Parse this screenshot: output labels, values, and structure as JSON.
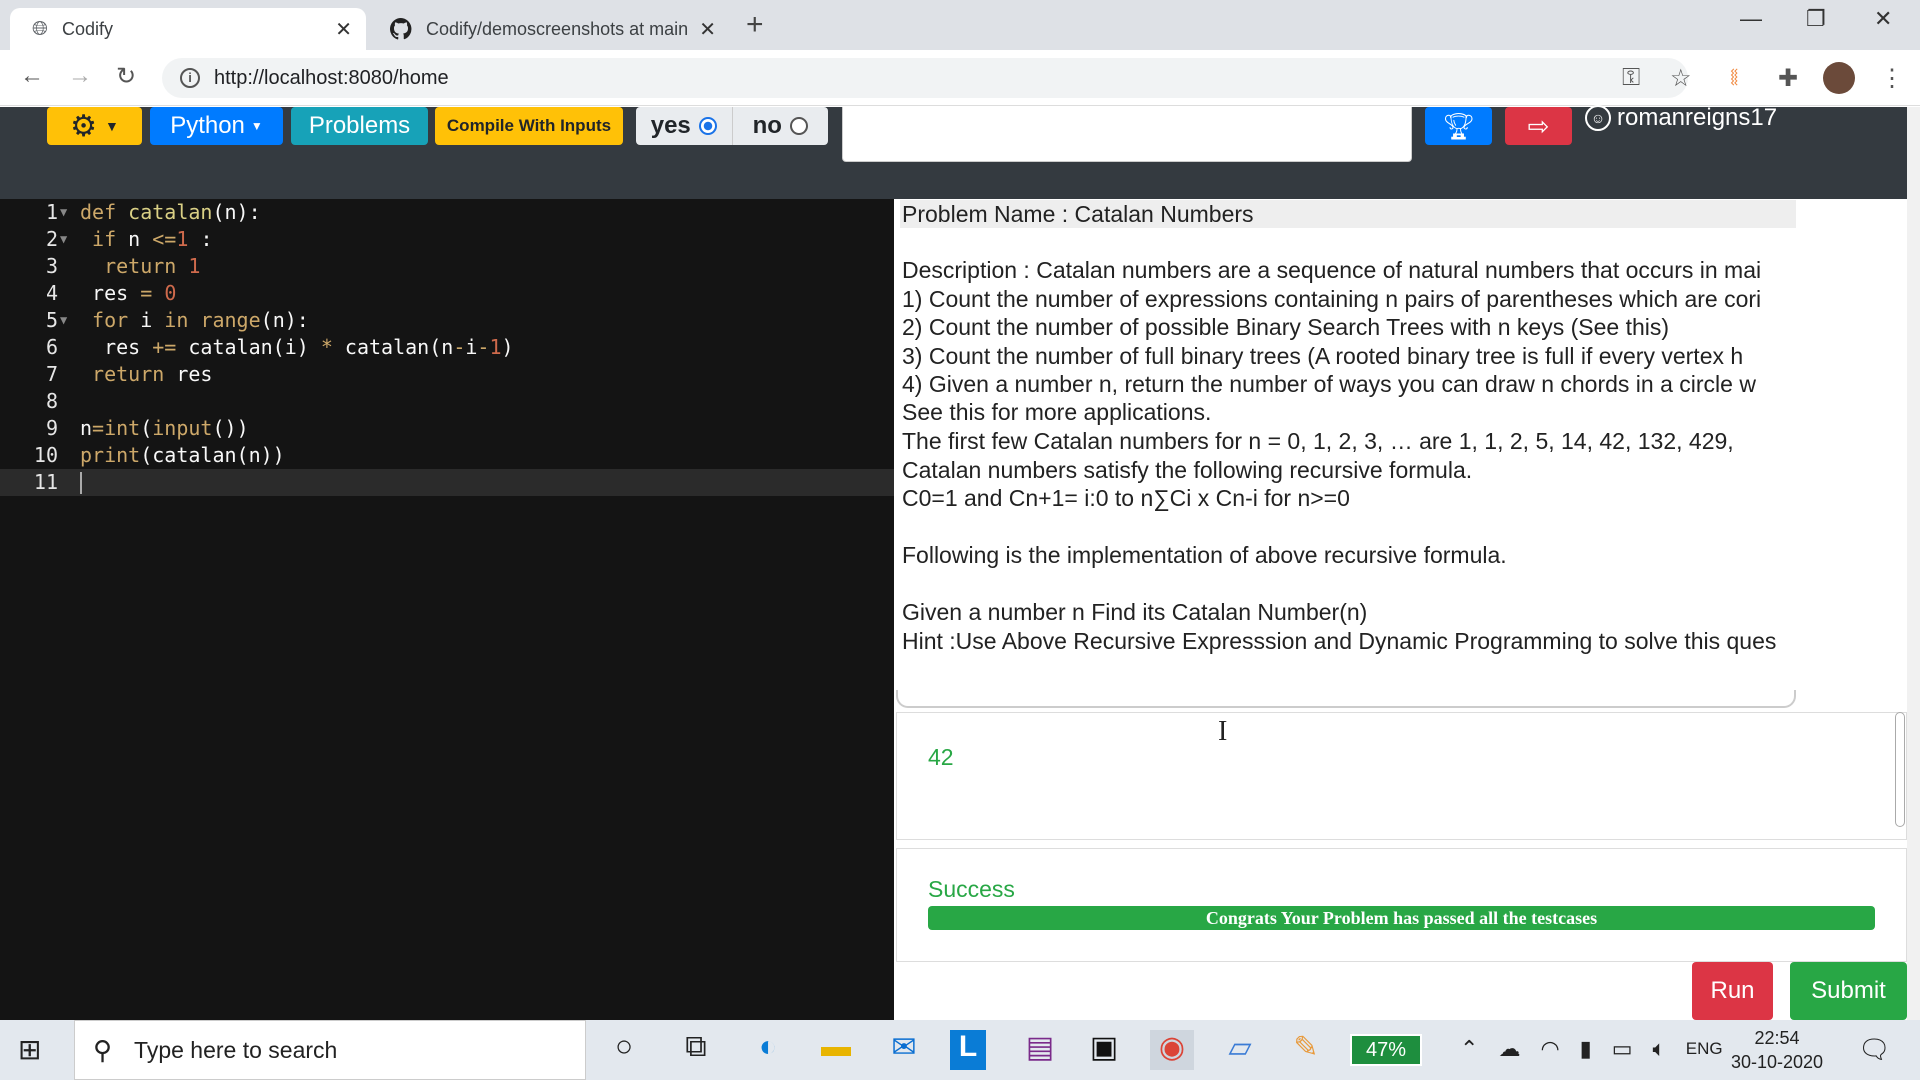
{
  "browser": {
    "tabs": [
      {
        "title": "Codify",
        "close": "✕"
      },
      {
        "title": "Codify/demoscreenshots at main",
        "close": "✕"
      }
    ],
    "new_tab": "+",
    "url": "http://localhost:8080/home",
    "icons": [
      "back-icon",
      "forward-icon",
      "reload-icon",
      "info-icon",
      "key-icon",
      "star-icon",
      "extension-icon",
      "puzzle-icon",
      "profile-avatar",
      "menu-icon"
    ]
  },
  "app": {
    "toolbar": {
      "language": "Python",
      "problems": "Problems",
      "compile_with_inputs": "Compile With Inputs",
      "yes": "yes",
      "no": "no",
      "selected_option": "yes",
      "username": "romanreigns17"
    },
    "editor": {
      "line_numbers": [
        "1",
        "2",
        "3",
        "4",
        "5",
        "6",
        "7",
        "8",
        "9",
        "10",
        "11"
      ]
    },
    "problem": {
      "name": "Problem Name : Catalan Numbers",
      "lines": [
        "Description : Catalan numbers are a sequence of natural numbers that occurs in mai",
        "1) Count the number of expressions containing n pairs of parentheses which are cori",
        "2) Count the number of possible Binary Search Trees with n keys (See this)",
        "3) Count the number of full binary trees (A rooted binary tree is full if every vertex h",
        "4) Given a number n, return the number of ways you can draw n chords in a circle w",
        "See this for more applications.",
        "The first few Catalan numbers for n = 0, 1, 2, 3, … are 1, 1, 2, 5, 14, 42, 132, 429,",
        "Catalan numbers satisfy the following recursive formula.",
        "C0=1 and Cn+1= i:0 to n∑Ci x Cn-i  for n>=0",
        "",
        "Following is the implementation of above recursive formula.",
        "",
        "Given a number n Find its Catalan Number(n)",
        "Hint :Use Above Recursive Expresssion and Dynamic Programming to solve this ques"
      ]
    },
    "output": {
      "value": "42"
    },
    "status": {
      "label": "Success",
      "message": "Congrats Your Problem has passed all the testcases"
    },
    "run": "Run",
    "submit": "Submit"
  },
  "taskbar": {
    "search_placeholder": "Type here to search",
    "battery": "47%",
    "language": "ENG",
    "time": "22:54",
    "date": "30-10-2020"
  },
  "colors": {
    "success": "#28a745",
    "danger": "#dc3545",
    "primary": "#007bff",
    "warning": "#ffc107",
    "info": "#17a2b8",
    "header": "#343a40",
    "editor_bg": "#141414"
  }
}
